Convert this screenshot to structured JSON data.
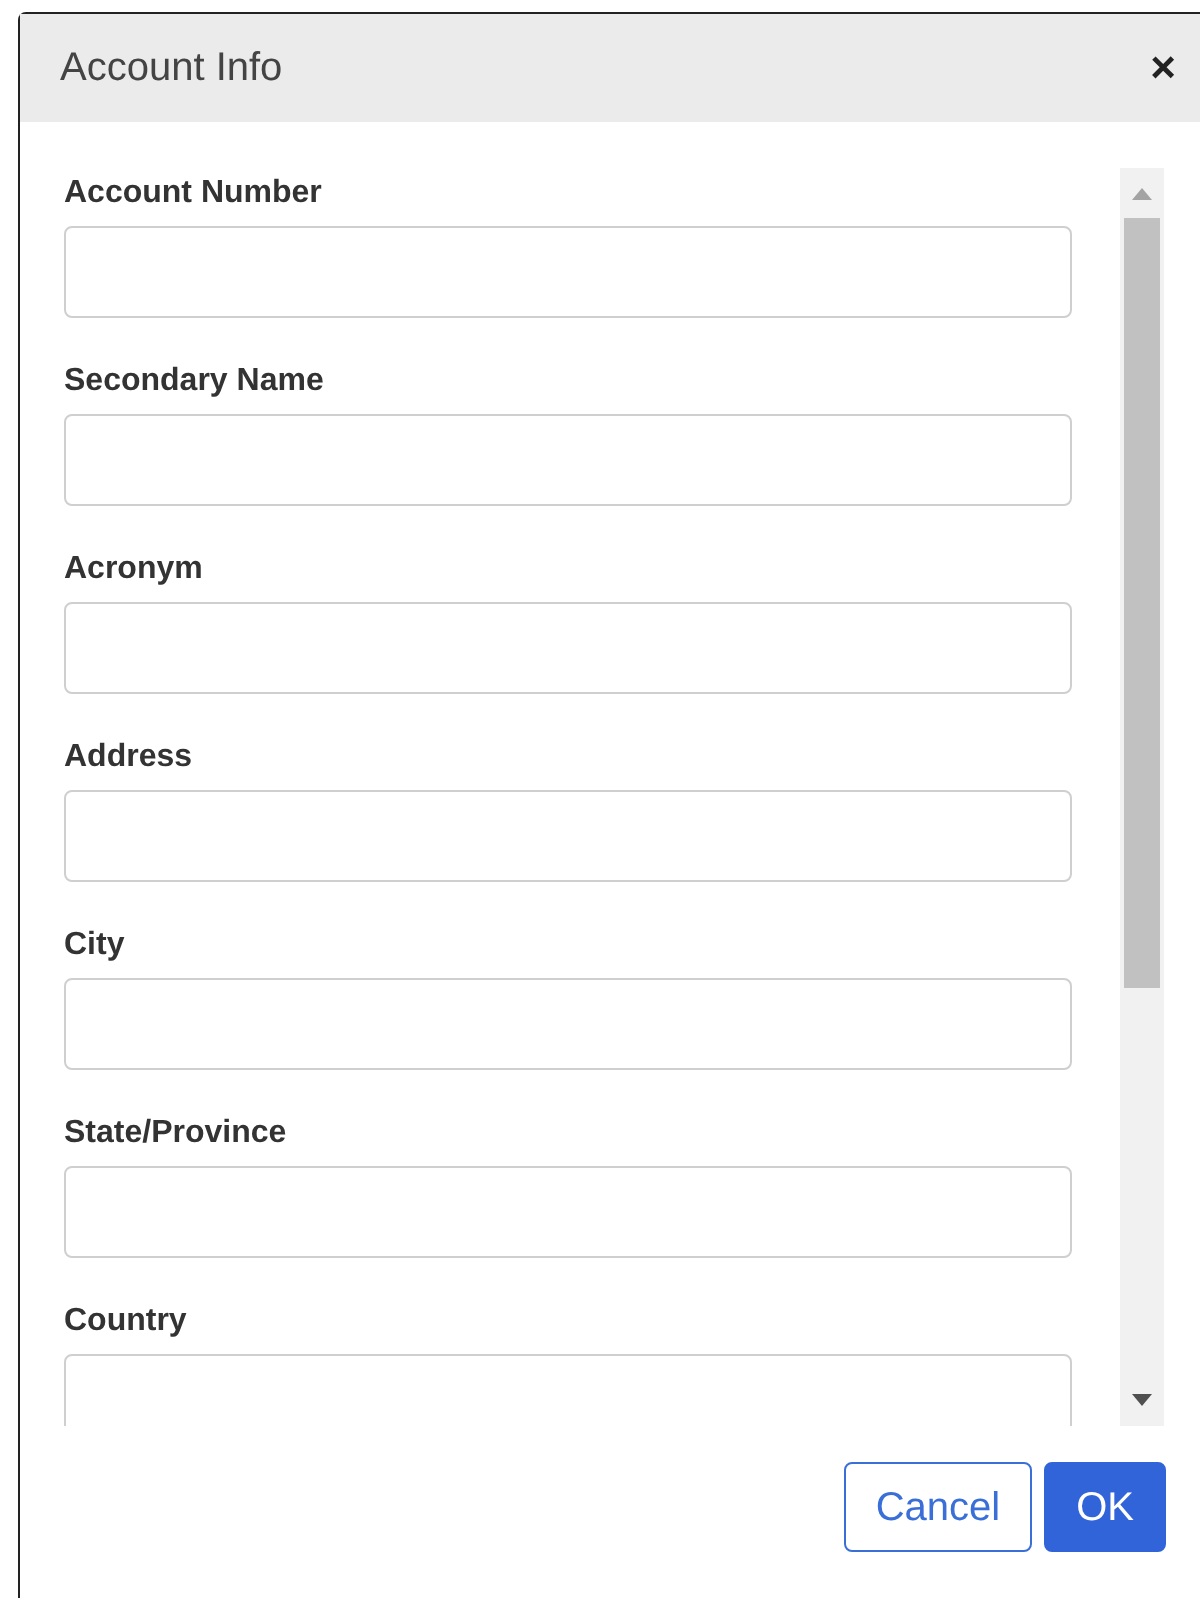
{
  "dialog": {
    "title": "Account Info",
    "close": "×"
  },
  "fields": [
    {
      "label": "Account Number"
    },
    {
      "label": "Secondary Name"
    },
    {
      "label": "Acronym"
    },
    {
      "label": "Address"
    },
    {
      "label": "City"
    },
    {
      "label": "State/Province"
    },
    {
      "label": "Country"
    }
  ],
  "buttons": [
    {
      "label": "Cancel",
      "kind": "secondary"
    },
    {
      "label": "OK",
      "kind": "primary"
    }
  ]
}
